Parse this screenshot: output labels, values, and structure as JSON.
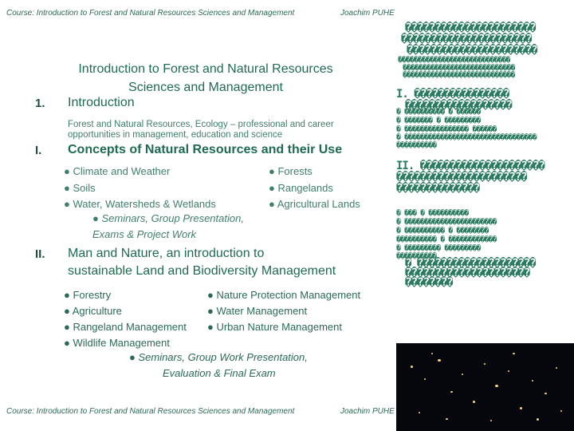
{
  "header": {
    "course": "Course: Introduction to Forest and Natural Resources Sciences and Management",
    "author": "Joachim PUHE"
  },
  "footer": {
    "course": "Course: Introduction to Forest and Natural Resources Sciences and Management",
    "author": "Joachim PUHE"
  },
  "title": {
    "line1": "Introduction to Forest and Natural Resources",
    "line2": "Sciences and Management"
  },
  "section1": {
    "number": "1.",
    "heading": "Introduction",
    "subtitle": "Forest and Natural Resources, Ecology – professional and career opportunities in management, education and science"
  },
  "section2": {
    "number": "I.",
    "heading": "Concepts of Natural Resources and their Use",
    "items_left": [
      "● Climate and Weather",
      "● Soils",
      "● Water, Watersheds & Wetlands"
    ],
    "items_right": [
      "● Forests",
      "● Rangelands",
      "● Agricultural Lands"
    ],
    "note1": "● Seminars, Group Presentation,",
    "note2": "Exams & Project Work"
  },
  "section3": {
    "number": "II.",
    "heading1": "Man and Nature, an introduction to",
    "heading2": "sustainable Land and Biodiversity Management",
    "items_left": [
      "● Forestry",
      "● Agriculture",
      "● Rangeland Management",
      "● Wildlife Management"
    ],
    "items_right": [
      "● Nature Protection Management",
      "● Water Management",
      "● Urban Nature Management"
    ],
    "note1": "● Seminars, Group Work Presentation,",
    "note2": "Evaluation & Final Exam"
  },
  "right_panel": {
    "row1": "����������������������",
    "row2": "����������������������",
    "row3": "����������������������",
    "row4": "����������������������������",
    "row5": "����������������������������",
    "row6": "����������������������������",
    "row7": "I. ����������������",
    "row8": "������������������",
    "row9": "� ����������         � ������",
    "row10": "� �������            � ���������",
    "row11": "� ����������������  ������",
    "row12": "� ���������������������������������",
    "row13": "����������",
    "row14": "II. ���������������������",
    "row15": "����������������������",
    "row16": "��������������",
    "row17": "� ���                  � ����������",
    "row18": "� �����������������������",
    "row19": "� ����������          � ��������",
    "row20": "����������          � ������������",
    "row21": "� ���������          ���������",
    "row22": "����������",
    "row23": "  � ��������������������",
    "row24": "  ���������������������",
    "row25": "  ��������"
  }
}
